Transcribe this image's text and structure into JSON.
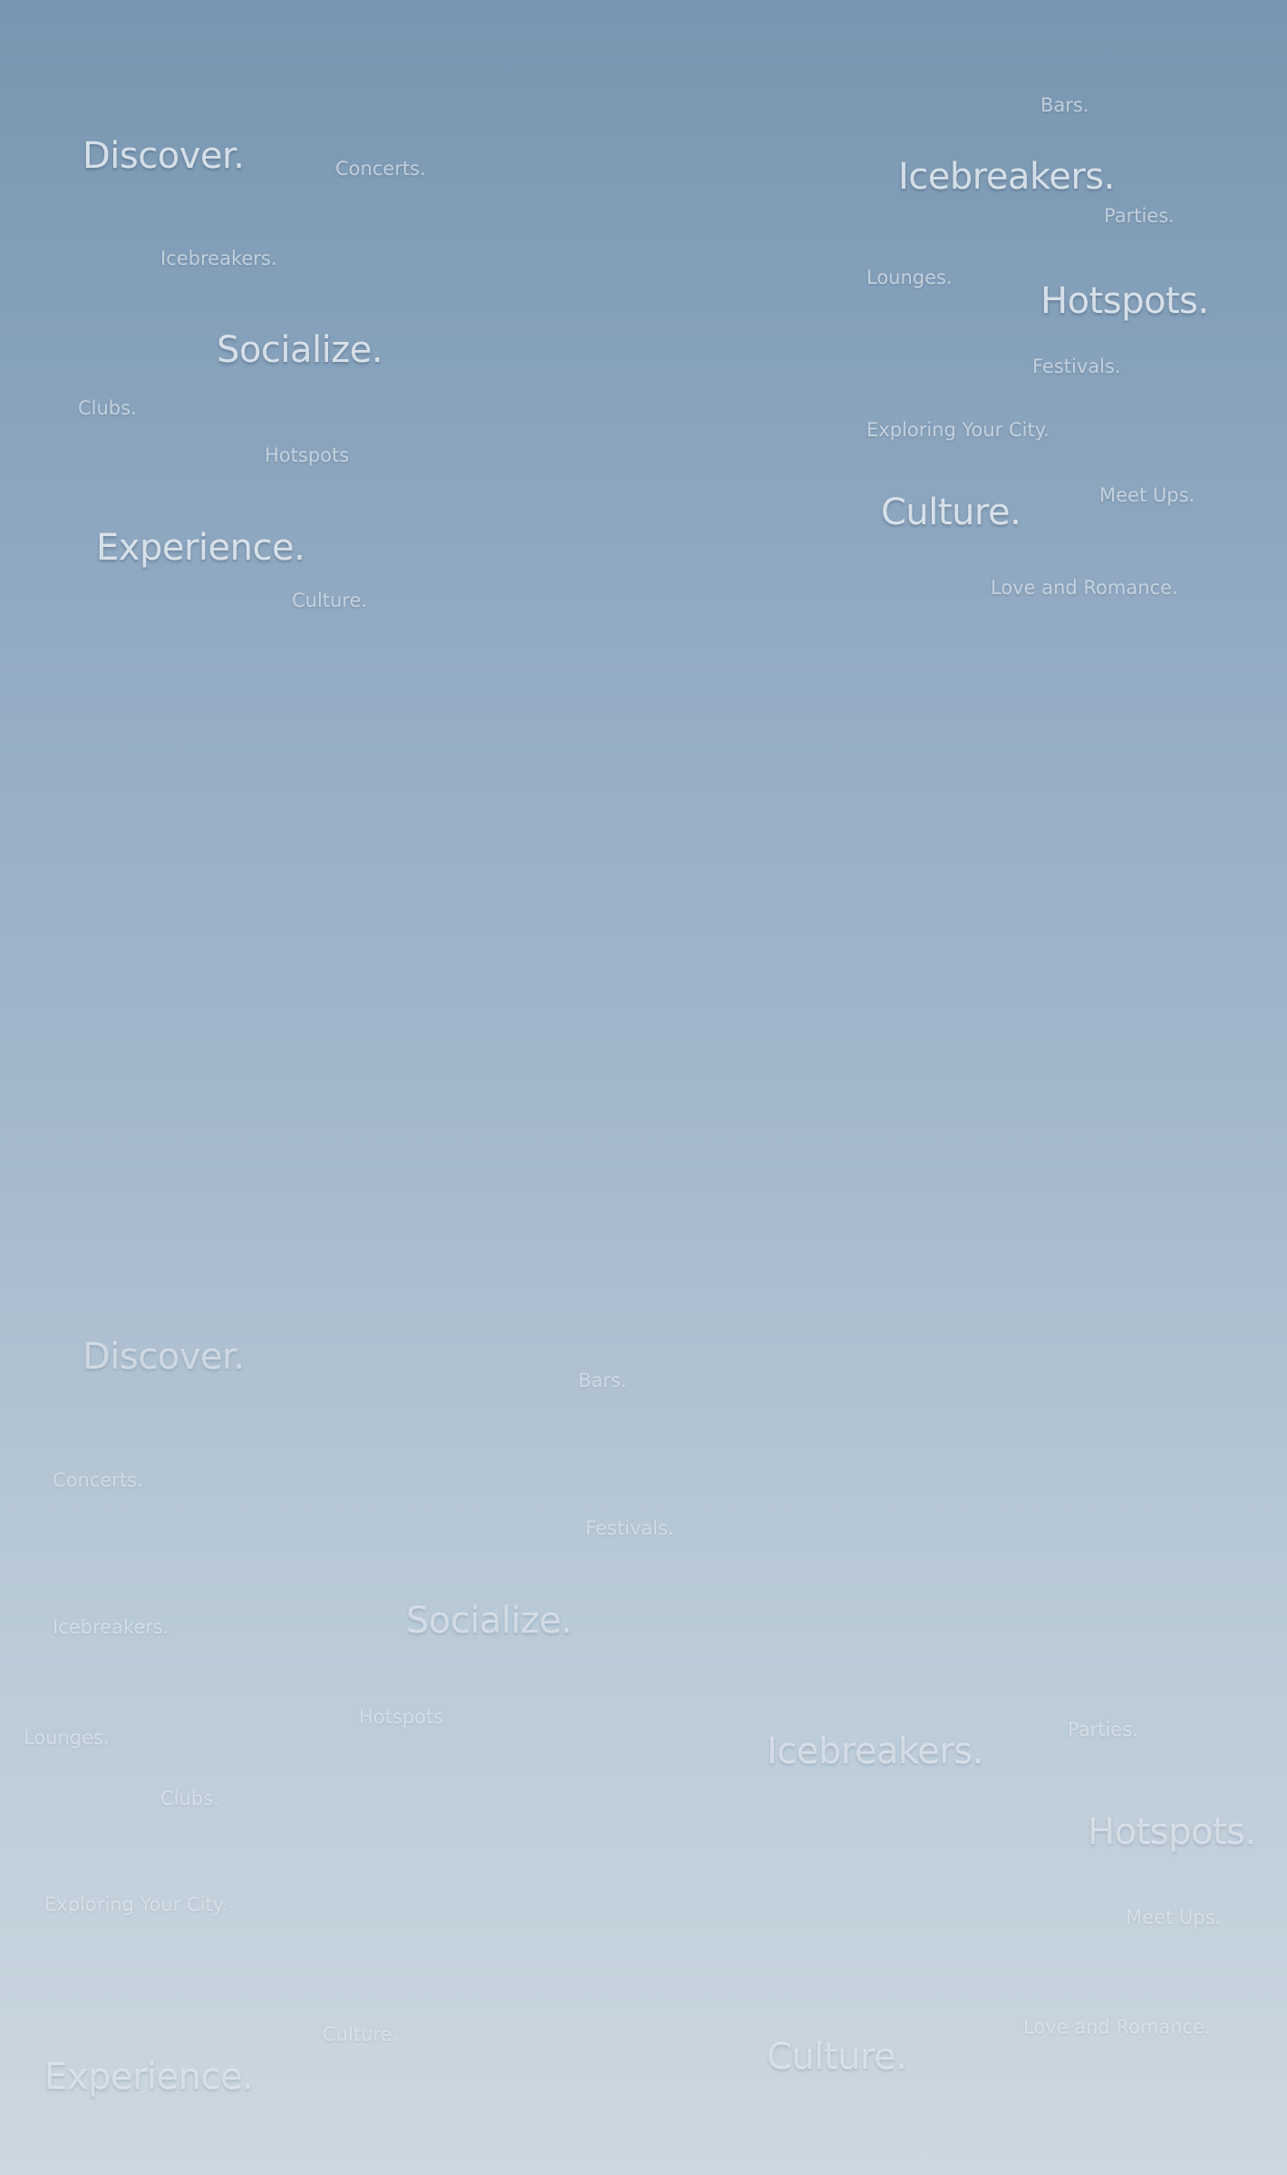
{
  "upper_cloud": {
    "discover": "Discover.",
    "concerts": "Concerts.",
    "icebreakers_small": "Icebreakers.",
    "socialize": "Socialize.",
    "clubs": "Clubs.",
    "hotspots_small": "Hotspots",
    "experience": "Experience.",
    "culture_small": "Culture.",
    "bars": "Bars.",
    "icebreakers_big": "Icebreakers.",
    "parties": "Parties.",
    "lounges": "Lounges.",
    "hotspots_big": "Hotspots.",
    "festivals": "Festivals.",
    "exploring": "Exploring Your City.",
    "meetups": "Meet Ups.",
    "culture_big": "Culture.",
    "love": "Love and Romance."
  },
  "lower_cloud": {
    "discover": "Discover.",
    "bars": "Bars.",
    "concerts": "Concerts.",
    "festivals": "Festivals.",
    "icebreakers_small": "Icebreakers.",
    "socialize": "Socialize.",
    "hotspots_small": "Hotspots",
    "lounges": "Lounges.",
    "parties": "Parties.",
    "icebreakers_big": "Icebreakers.",
    "clubs": "Clubs.",
    "hotspots_big": "Hotspots.",
    "exploring": "Exploring Your City.",
    "meetups": "Meet Ups.",
    "culture_small": "Culture.",
    "love": "Love and Romance.",
    "culture_big": "Culture.",
    "experience": "Experience."
  }
}
